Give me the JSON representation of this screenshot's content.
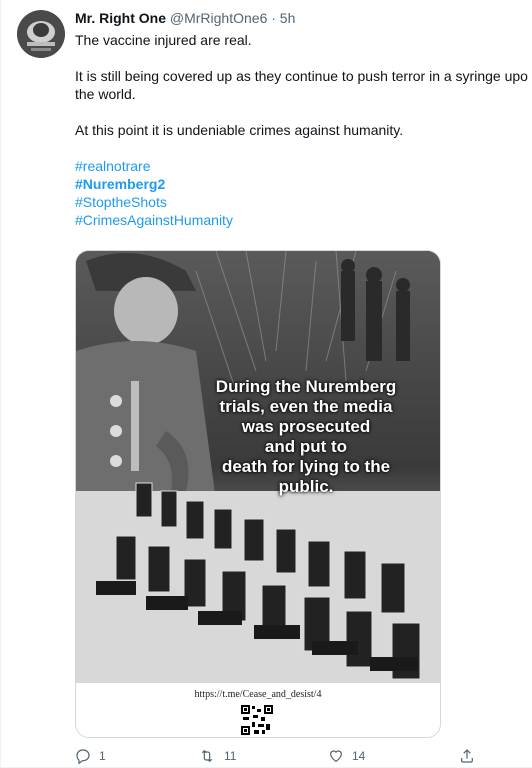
{
  "tweet": {
    "author_name": "Mr. Right One",
    "handle_time": "@MrRightOne6 · 5h",
    "lines": [
      "The vaccine injured are real.",
      "It is still being covered up as they continue to push terror in a syringe upo",
      "the world.",
      "At this point it is undeniable crimes against humanity."
    ],
    "hashtags": [
      "#realnotrare",
      "#Nuremberg2",
      "#StoptheShots",
      "#CrimesAgainstHumanity"
    ]
  },
  "media": {
    "caption_lines": [
      "During the Nuremberg",
      "trials, even the media",
      "was prosecuted",
      "and put to",
      "death for lying to the",
      "public."
    ],
    "link": "https://t.me/Cease_and_desist/4"
  },
  "actions": {
    "reply_count": "1",
    "retweet_count": "11",
    "like_count": "14"
  },
  "colors": {
    "accent": "#1d9bf0",
    "secondary_text": "#536471",
    "border": "#cfd9de"
  }
}
